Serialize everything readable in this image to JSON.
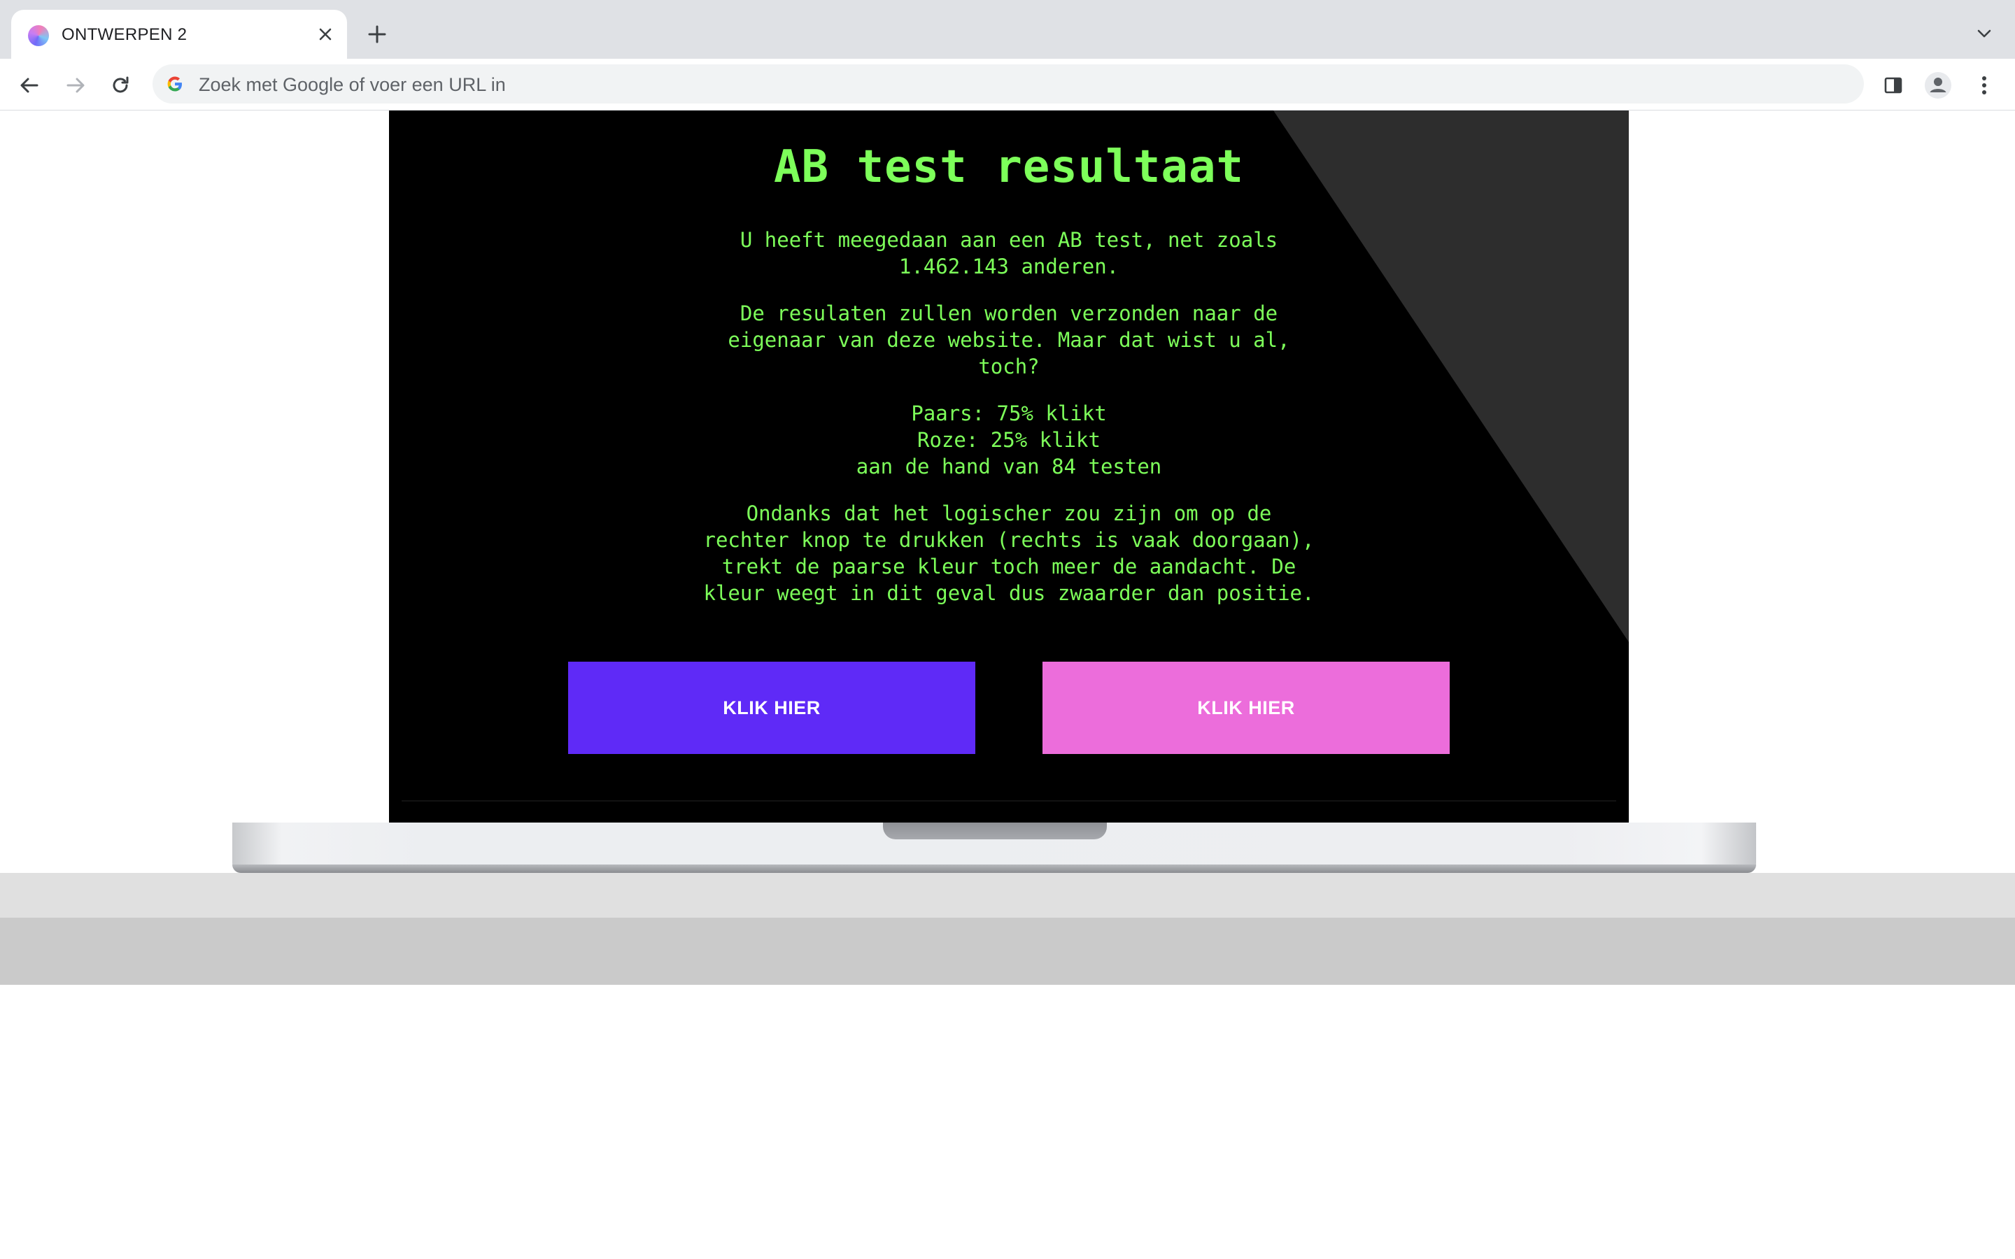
{
  "browser": {
    "tab_title": "ONTWERPEN 2",
    "address_placeholder": "Zoek met Google of voer een URL in"
  },
  "page": {
    "title": "AB test resultaat",
    "paragraphs": [
      "U heeft meegedaan aan een AB test, net zoals\n1.462.143 anderen.",
      "De resulaten zullen worden verzonden naar de\neigenaar van deze website. Maar dat wist u al,\ntoch?",
      "Paars: 75% klikt\nRoze: 25% klikt\naan de hand van 84 testen",
      "Ondanks dat het logischer zou zijn om op de\nrechter knop te drukken (rechts is vaak doorgaan),\ntrekt de paarse kleur toch meer de aandacht. De\nkleur weegt in dit geval dus zwaarder dan positie."
    ],
    "buttons": {
      "purple_label": "KLIK HIER",
      "pink_label": "KLIK HIER"
    }
  },
  "colors": {
    "text_green": "#7dff5a",
    "button_purple": "#5f2af7",
    "button_pink": "#ec6ddb",
    "screen_bg": "#000000"
  },
  "icons": [
    "app-favicon",
    "close-icon",
    "plus-icon",
    "chevron-down-icon",
    "back-arrow-icon",
    "forward-arrow-icon",
    "reload-icon",
    "google-icon",
    "side-panel-icon",
    "profile-icon",
    "kebab-menu-icon"
  ]
}
